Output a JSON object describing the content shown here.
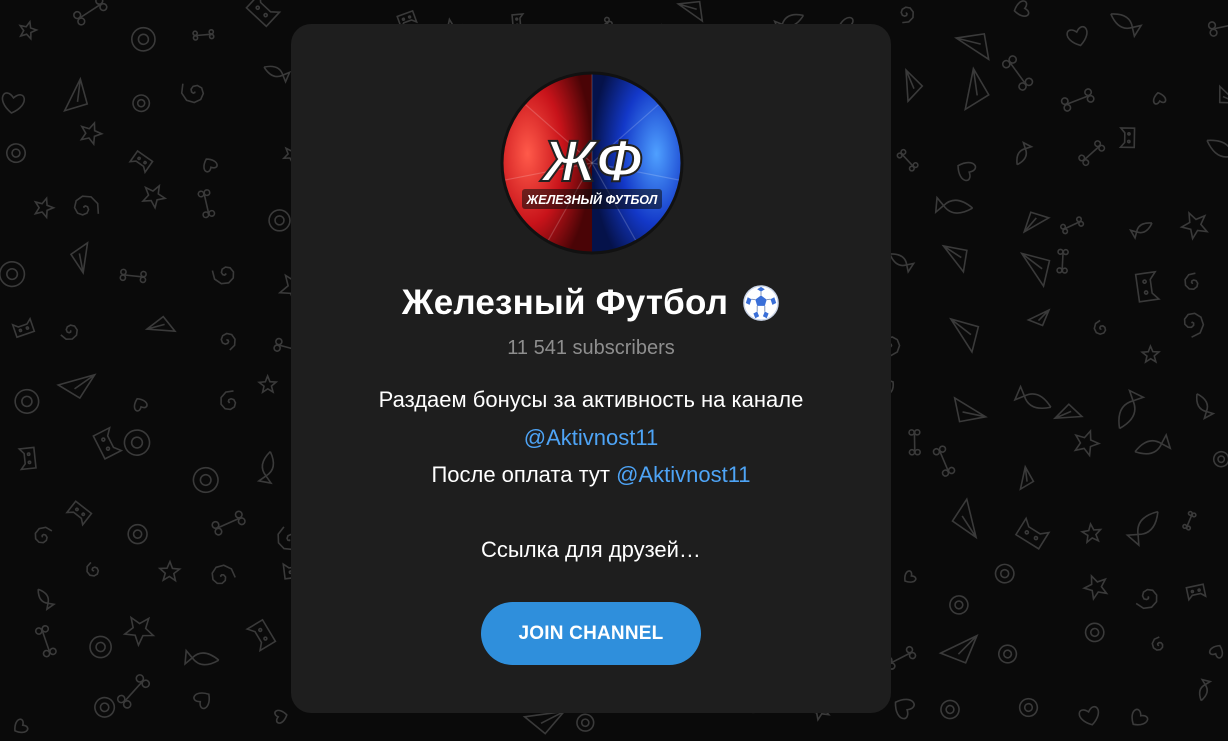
{
  "colors": {
    "background": "#0a0a0a",
    "card": "#1e1e1e",
    "accent_link": "#4ea4f6",
    "button": "#2f8fdc",
    "muted": "#8e8e8e",
    "avatar_left": "#d91c1c",
    "avatar_right": "#1a4fd8"
  },
  "channel": {
    "avatar_icon": "channel-logo",
    "avatar_title_letters": "ЖФ",
    "avatar_subtitle": "ЖЕЛЕЗНЫЙ ФУТБОЛ",
    "name": "Железный Футбол",
    "name_emoji_icon": "soccer-ball-icon",
    "subscribers": "11 541 subscribers"
  },
  "description": {
    "line1": "Раздаем бонусы за активность на канале",
    "line2_link": "@Aktivnost11",
    "line3_text": "После оплата тут ",
    "line3_link": "@Aktivnost11",
    "line5": "Ссылка для друзей…"
  },
  "join_button": {
    "label": "JOIN CHANNEL"
  }
}
